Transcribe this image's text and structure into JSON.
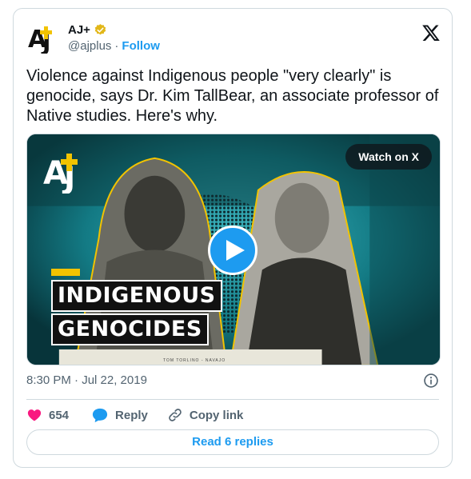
{
  "author": {
    "name": "AJ+",
    "handle": "@ajplus",
    "separator": "·",
    "follow_label": "Follow",
    "verified": true
  },
  "tweet": {
    "text": "Violence against Indigenous people \"very clearly\" is genocide, says Dr. Kim TallBear, an associate professor of Native studies. Here's why."
  },
  "media": {
    "watch_label": "Watch on X",
    "overlay_title_line1": "INDIGENOUS",
    "overlay_title_line2": "GENOCIDES",
    "caption": "TOM TORLINO - NAVAJO"
  },
  "meta": {
    "timestamp": "8:30 PM · Jul 22, 2019"
  },
  "actions": {
    "like_count": "654",
    "reply_label": "Reply",
    "copy_link_label": "Copy link"
  },
  "footer": {
    "read_replies_label": "Read 6 replies"
  },
  "colors": {
    "accent": "#1d9bf0",
    "like": "#f91880",
    "text_secondary": "#536471",
    "border": "#cfd9de",
    "verified_badge": "#e2b719",
    "brand_yellow": "#f2c300"
  },
  "icons": {
    "logo": "aj-plus-logo",
    "verified": "verified-badge-icon",
    "x": "x-logo-icon",
    "play": "play-icon",
    "info": "info-icon",
    "heart": "heart-icon",
    "reply": "reply-bubble-icon",
    "link": "link-icon"
  }
}
